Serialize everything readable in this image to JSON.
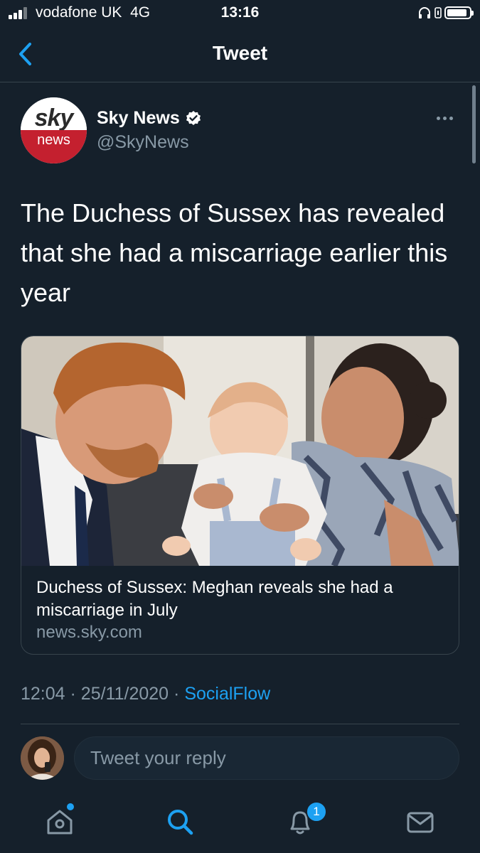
{
  "status_bar": {
    "carrier": "vodafone UK",
    "network": "4G",
    "time": "13:16",
    "battery_level": 0.9
  },
  "nav": {
    "title": "Tweet",
    "back_icon": "chevron-left-icon"
  },
  "tweet": {
    "author_name": "Sky News",
    "author_handle": "@SkyNews",
    "avatar_text_top": "sky",
    "avatar_text_bottom": "news",
    "verified_icon": "verified-badge-icon",
    "text": "The Duchess of Sussex has revealed that she had a miscarriage earlier this year",
    "card": {
      "title": "Duchess of Sussex: Meghan reveals she had a miscarriage in July",
      "domain": "news.sky.com"
    },
    "time": "12:04",
    "date": "25/11/2020",
    "separator": "·",
    "source": "SocialFlow"
  },
  "reply": {
    "placeholder": "Tweet your reply"
  },
  "tab_bar": {
    "notification_count": "1",
    "tabs": [
      "home-icon",
      "search-icon",
      "bell-icon",
      "mail-icon"
    ]
  },
  "colors": {
    "background": "#15202b",
    "accent": "#1da1f2",
    "secondary_text": "#8899a6",
    "sky_red": "#c4202f"
  }
}
